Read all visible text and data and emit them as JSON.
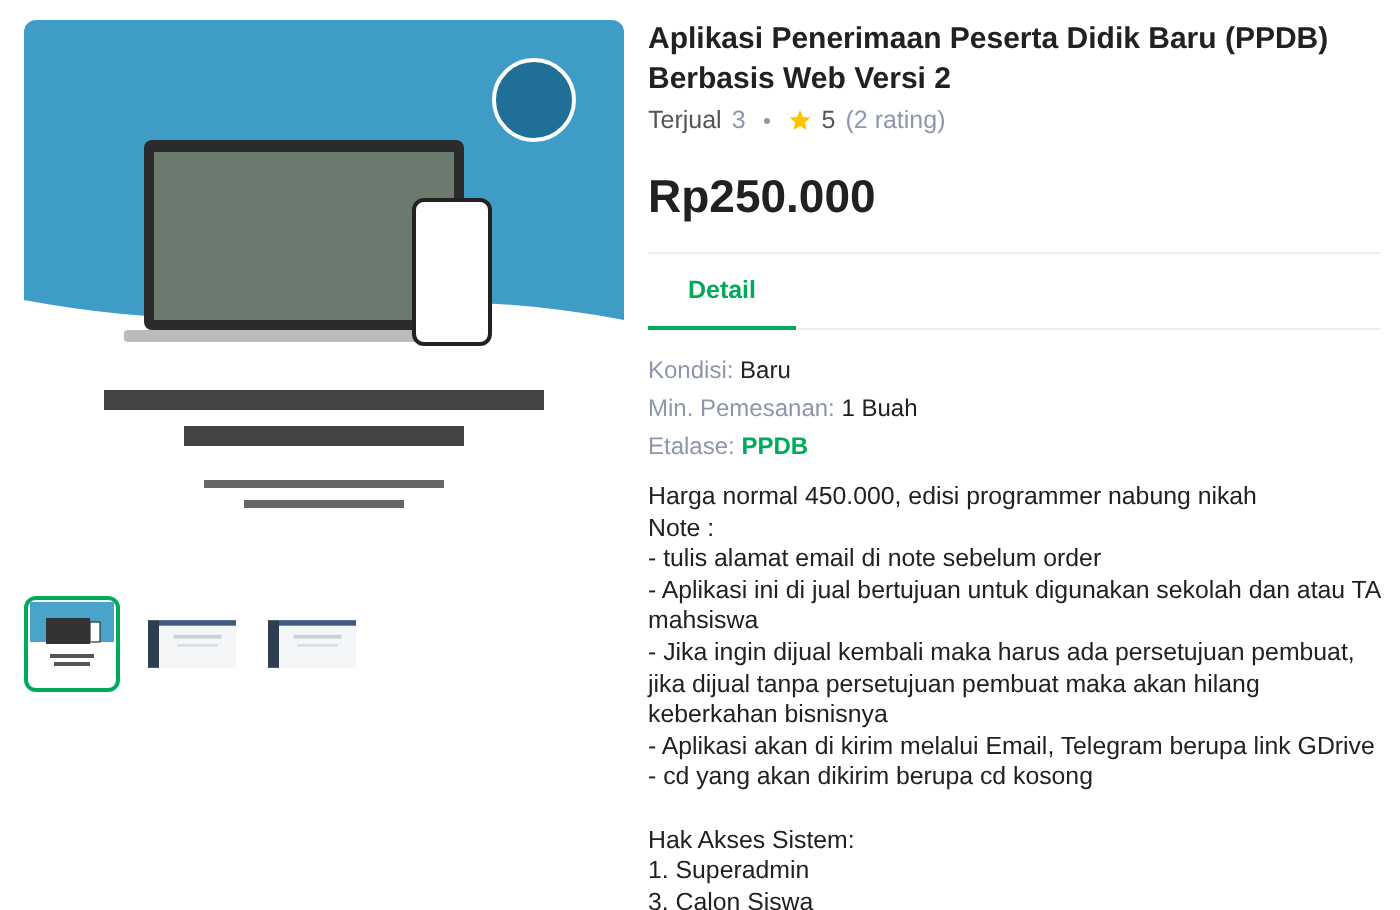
{
  "gallery": {
    "thumbnails": [
      {
        "selected": true
      },
      {
        "selected": false
      },
      {
        "selected": false
      }
    ]
  },
  "product": {
    "title": "Aplikasi Penerimaan Peserta Didik Baru (PPDB) Berbasis Web Versi 2",
    "sold_label": "Terjual",
    "sold_count": "3",
    "rating": "5",
    "rating_count": "(2 rating)",
    "price": "Rp250.000"
  },
  "tabs": [
    {
      "label": "Detail",
      "selected": true
    }
  ],
  "details": [
    {
      "label": "Kondisi:",
      "value": "Baru",
      "kind": "plain"
    },
    {
      "label": "Min. Pemesanan:",
      "value": "1 Buah",
      "kind": "plain"
    },
    {
      "label": "Etalase:",
      "value": "PPDB",
      "kind": "link"
    }
  ],
  "description": [
    [
      "Harga normal 450.000, edisi programmer nabung nikah",
      "Note :",
      "- tulis alamat email di note sebelum order",
      "- Aplikasi ini di jual bertujuan untuk digunakan sekolah dan atau TA mahsiswa",
      "- Jika ingin dijual kembali maka harus ada persetujuan pembuat, jika dijual tanpa persetujuan pembuat maka akan hilang keberkahan bisnisnya",
      "- Aplikasi akan di kirim melalui Email, Telegram berupa link GDrive",
      "- cd yang akan dikirim berupa cd kosong"
    ],
    [
      "Hak Akses Sistem:",
      "1. Superadmin",
      "3. Calon Siswa"
    ]
  ]
}
